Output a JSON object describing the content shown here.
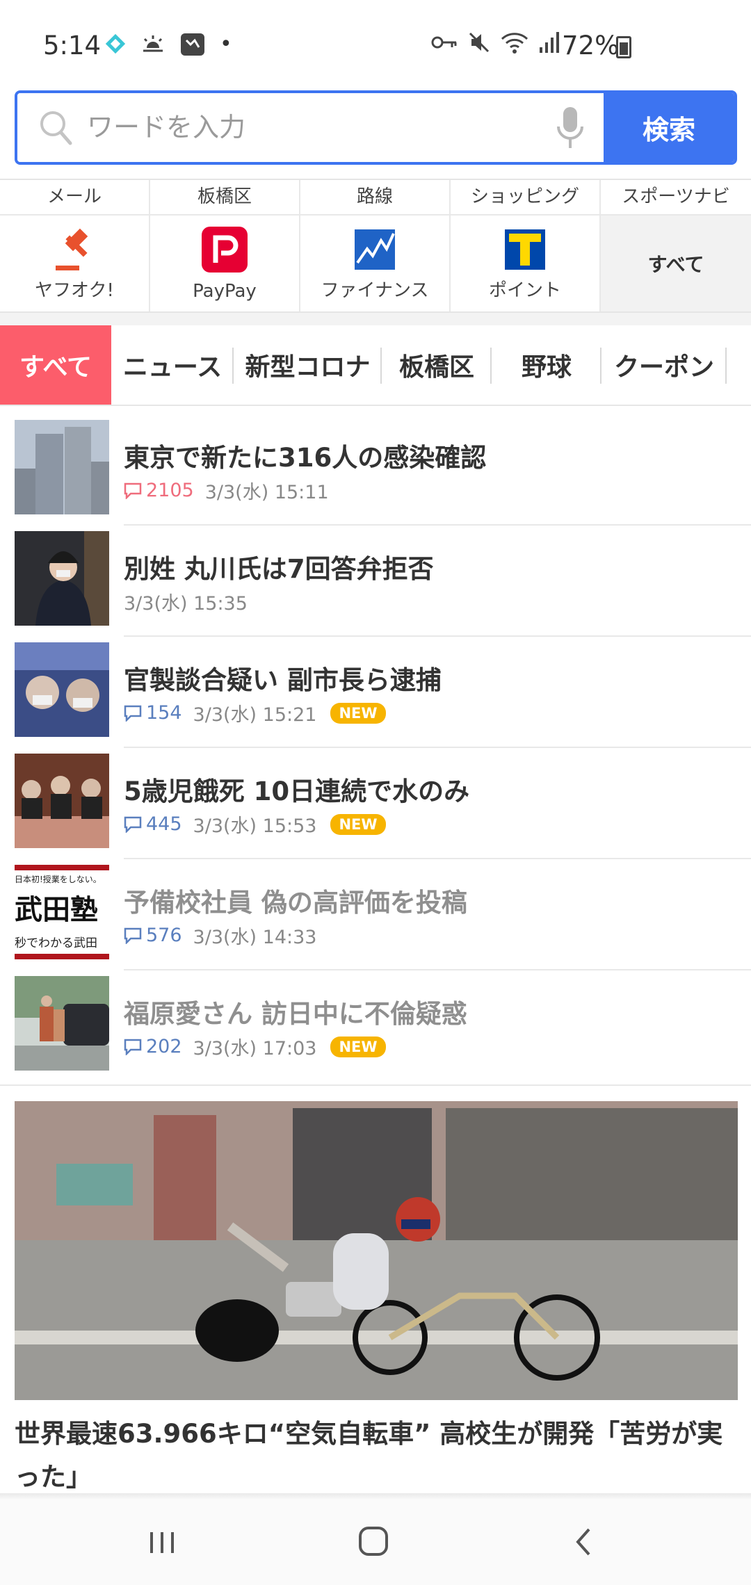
{
  "status_bar": {
    "time": "5:14",
    "dot": "•",
    "battery": "72%",
    "icons_left": [
      "app-diamond-icon",
      "weather-icon",
      "notification-icon"
    ],
    "icons_right": [
      "vpn-key-icon",
      "mute-icon",
      "wifi-icon",
      "signal-icon",
      "battery-icon"
    ]
  },
  "search": {
    "placeholder": "ワードを入力",
    "button_label": "検索"
  },
  "services": {
    "text_links": [
      "メール",
      "板橋区",
      "路線",
      "ショッピング",
      "スポーツナビ"
    ],
    "apps": [
      {
        "label": "ヤフオク!",
        "icon": "auction-gavel-icon"
      },
      {
        "label": "PayPay",
        "icon": "paypay-icon"
      },
      {
        "label": "ファイナンス",
        "icon": "finance-chart-icon"
      },
      {
        "label": "ポイント",
        "icon": "tpoint-icon"
      }
    ],
    "all_label": "すべて"
  },
  "tabs": [
    "すべて",
    "ニュース",
    "新型コロナ",
    "板橋区",
    "野球",
    "クーポン"
  ],
  "news": [
    {
      "title": "東京で新たに316人の感染確認",
      "comments": "2105",
      "date": "3/3(水) 15:11",
      "new": "",
      "read": false,
      "hot": true
    },
    {
      "title": "別姓 丸川氏は7回答弁拒否",
      "comments": "",
      "date": "3/3(水) 15:35",
      "new": "",
      "read": false,
      "hot": false
    },
    {
      "title": "官製談合疑い 副市長ら逮捕",
      "comments": "154",
      "date": "3/3(水) 15:21",
      "new": "NEW",
      "read": false,
      "hot": false
    },
    {
      "title": "5歳児餓死 10日連続で水のみ",
      "comments": "445",
      "date": "3/3(水) 15:53",
      "new": "NEW",
      "read": false,
      "hot": false
    },
    {
      "title": "予備校社員 偽の高評価を投稿",
      "comments": "576",
      "date": "3/3(水) 14:33",
      "new": "",
      "read": true,
      "hot": false
    },
    {
      "title": "福原愛さん 訪日中に不倫疑惑",
      "comments": "202",
      "date": "3/3(水) 17:03",
      "new": "NEW",
      "read": true,
      "hot": false
    }
  ],
  "thumb_text": {
    "line1": "日本初!授業をしない。",
    "line2": "武田塾",
    "line3": "秒でわかる武田"
  },
  "feature": {
    "title": "世界最速63.966キロ“空気自転車” 高校生が開発「苦労が実った」"
  },
  "nav": [
    "recents-icon",
    "home-icon",
    "back-icon"
  ]
}
